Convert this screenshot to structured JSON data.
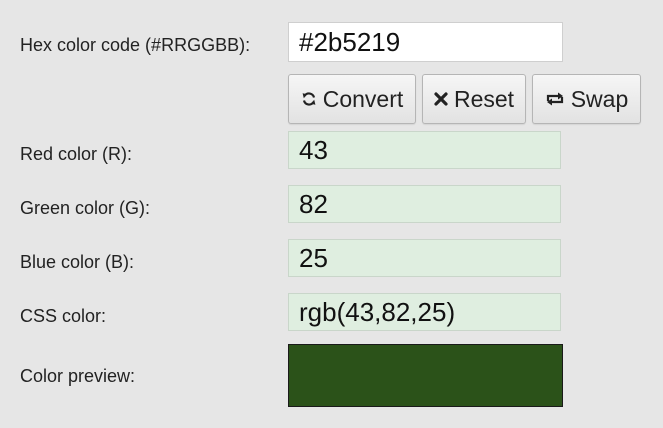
{
  "form": {
    "hex_label": "Hex color code (#RRGGBB):",
    "hex_value": "#2b5219",
    "red_label": "Red color (R):",
    "red_value": "43",
    "green_label": "Green color (G):",
    "green_value": "82",
    "blue_label": "Blue color (B):",
    "blue_value": "25",
    "css_label": "CSS color:",
    "css_value": "rgb(43,82,25)",
    "preview_label": "Color preview:",
    "preview_color": "#2b5219"
  },
  "buttons": {
    "convert_label": "Convert",
    "convert_icon": "refresh-icon",
    "reset_label": "Reset",
    "reset_icon": "close-icon",
    "swap_label": "Swap",
    "swap_icon": "swap-icon"
  },
  "colors": {
    "page_background": "#e6e6e6",
    "output_background": "#dfeee0"
  }
}
